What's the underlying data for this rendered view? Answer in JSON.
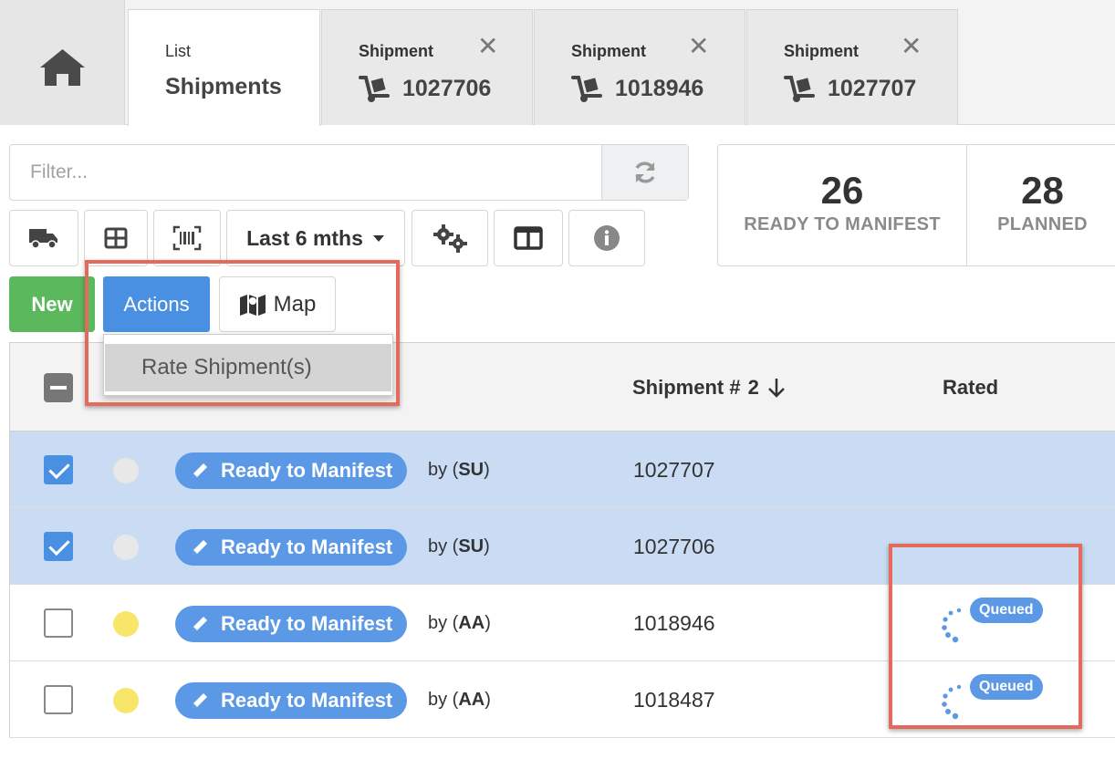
{
  "tabs": {
    "home_label": "Home",
    "list": {
      "small": "List",
      "big": "Shipments"
    },
    "shipment_tabs": [
      {
        "small": "Shipment",
        "number": "1027706"
      },
      {
        "small": "Shipment",
        "number": "1018946"
      },
      {
        "small": "Shipment",
        "number": "1027707"
      }
    ]
  },
  "filter": {
    "placeholder": "Filter..."
  },
  "toolbar": {
    "range_label": "Last 6 mths"
  },
  "stats": [
    {
      "value": "26",
      "label": "READY TO MANIFEST"
    },
    {
      "value": "28",
      "label": "PLANNED"
    }
  ],
  "actions": {
    "new_label": "New",
    "actions_label": "Actions",
    "map_label": "Map",
    "menu_item": "Rate Shipment(s)"
  },
  "table": {
    "columns": {
      "shipment": "Shipment #",
      "sort_index": "2",
      "rated": "Rated"
    },
    "rows": [
      {
        "checked": true,
        "dot_color": "#e8e8e8",
        "status": "Ready to Manifest",
        "by_prefix": "by (",
        "by_user": "SU",
        "by_suffix": ")",
        "shipment": "1027707",
        "rated": ""
      },
      {
        "checked": true,
        "dot_color": "#e8e8e8",
        "status": "Ready to Manifest",
        "by_prefix": "by (",
        "by_user": "SU",
        "by_suffix": ")",
        "shipment": "1027706",
        "rated": ""
      },
      {
        "checked": false,
        "dot_color": "#f7e66a",
        "status": "Ready to Manifest",
        "by_prefix": "by (",
        "by_user": "AA",
        "by_suffix": ")",
        "shipment": "1018946",
        "rated": "Queued"
      },
      {
        "checked": false,
        "dot_color": "#f7e66a",
        "status": "Ready to Manifest",
        "by_prefix": "by (",
        "by_user": "AA",
        "by_suffix": ")",
        "shipment": "1018487",
        "rated": "Queued"
      }
    ]
  },
  "colors": {
    "accent": "#4a90e2",
    "new_green": "#5cb85c",
    "highlight": "#e46b5c",
    "selected_row": "#c9dcf4"
  }
}
